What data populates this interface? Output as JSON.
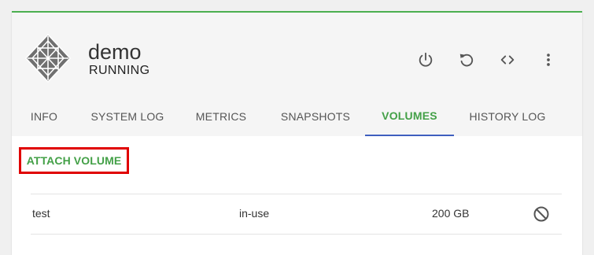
{
  "instance": {
    "name": "demo",
    "status": "RUNNING"
  },
  "actions": {
    "power_icon": "power-icon",
    "reboot_icon": "refresh-icon",
    "console_icon": "code-icon",
    "more_icon": "more-vert-icon"
  },
  "tabs": [
    {
      "label": "INFO"
    },
    {
      "label": "SYSTEM LOG"
    },
    {
      "label": "METRICS"
    },
    {
      "label": "SNAPSHOTS"
    },
    {
      "label": "VOLUMES"
    },
    {
      "label": "HISTORY LOG"
    }
  ],
  "active_tab": "VOLUMES",
  "volumes": {
    "attach_label": "ATTACH VOLUME",
    "rows": [
      {
        "name": "test",
        "state": "in-use",
        "size": "200 GB",
        "action_icon": "block-icon"
      }
    ]
  },
  "colors": {
    "accent_green": "#43a047",
    "active_underline": "#3f5fbf",
    "highlight_red": "#e00000"
  }
}
